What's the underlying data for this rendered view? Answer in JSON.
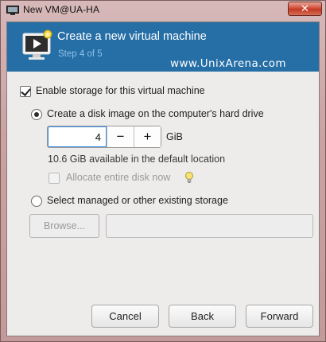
{
  "window": {
    "title": "New VM@UA-HA",
    "close_glyph": "✕"
  },
  "header": {
    "title": "Create a new virtual machine",
    "step": "Step 4 of 5",
    "watermark": "www.UnixArena.com",
    "background": "#266ea6"
  },
  "storage": {
    "enable_label": "Enable storage for this virtual machine",
    "enable_checked": true,
    "option_disk_label": "Create a disk image on the computer's hard drive",
    "option_disk_selected": true,
    "size_value": "4",
    "decrement_glyph": "−",
    "increment_glyph": "+",
    "size_unit": "GiB",
    "available_text": "10.6 GiB available in the default location",
    "allocate_label": "Allocate entire disk now",
    "allocate_checked": false,
    "option_managed_label": "Select managed or other existing storage",
    "option_managed_selected": false,
    "browse_label": "Browse...",
    "path_value": ""
  },
  "footer": {
    "cancel_label": "Cancel",
    "back_label": "Back",
    "forward_label": "Forward"
  }
}
